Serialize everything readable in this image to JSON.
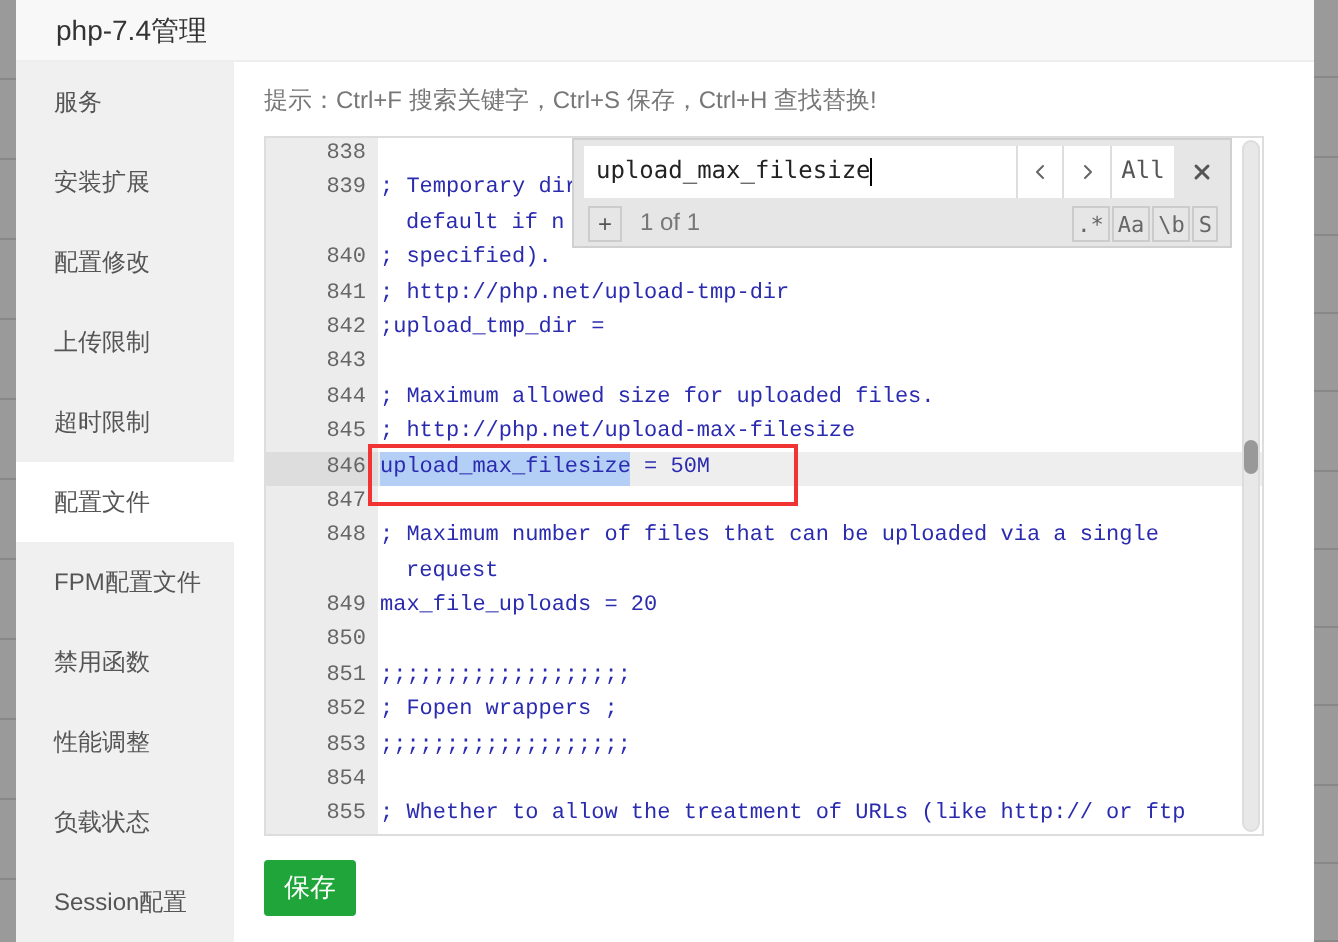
{
  "window": {
    "title": "php-7.4管理"
  },
  "sidebar": {
    "items": [
      {
        "label": "服务",
        "selected": false
      },
      {
        "label": "安装扩展",
        "selected": false
      },
      {
        "label": "配置修改",
        "selected": false
      },
      {
        "label": "上传限制",
        "selected": false
      },
      {
        "label": "超时限制",
        "selected": false
      },
      {
        "label": "配置文件",
        "selected": true
      },
      {
        "label": "FPM配置文件",
        "selected": false
      },
      {
        "label": "禁用函数",
        "selected": false
      },
      {
        "label": "性能调整",
        "selected": false
      },
      {
        "label": "负载状态",
        "selected": false
      },
      {
        "label": "Session配置",
        "selected": false
      }
    ]
  },
  "hint": "提示：Ctrl+F 搜索关键字，Ctrl+S 保存，Ctrl+H 查找替换!",
  "editor": {
    "lines": [
      {
        "number": "838",
        "current": false
      },
      {
        "number": "839",
        "text": "; Temporary dir",
        "continuation": "default if n",
        "current": false
      },
      {
        "number": "840",
        "text": "; specified).",
        "current": false
      },
      {
        "number": "841",
        "text": "; http://php.net/upload-tmp-dir",
        "current": false
      },
      {
        "number": "842",
        "text": ";upload_tmp_dir =",
        "current": false
      },
      {
        "number": "843",
        "current": false
      },
      {
        "number": "844",
        "text": "; Maximum allowed size for uploaded files.",
        "current": false
      },
      {
        "number": "845",
        "text": "; http://php.net/upload-max-filesize",
        "current": false
      },
      {
        "number": "846",
        "match": "upload_max_filesize",
        "text": " = 50M",
        "current": true,
        "highlighted": true
      },
      {
        "number": "847",
        "current": false
      },
      {
        "number": "848",
        "text": "; Maximum number of files that can be uploaded via a single",
        "continuation": "request",
        "current": false
      },
      {
        "number": "849",
        "text": "max_file_uploads = 20",
        "current": false
      },
      {
        "number": "850",
        "current": false
      },
      {
        "number": "851",
        "text": ";;;;;;;;;;;;;;;;;;;",
        "current": false
      },
      {
        "number": "852",
        "text": "; Fopen wrappers ;",
        "current": false
      },
      {
        "number": "853",
        "text": ";;;;;;;;;;;;;;;;;;;",
        "current": false
      },
      {
        "number": "854",
        "current": false
      },
      {
        "number": "855",
        "text": "; Whether to allow the treatment of URLs (like http:// or ftp",
        "current": false
      }
    ]
  },
  "search": {
    "query": "upload_max_filesize",
    "all": "All",
    "plus": "+",
    "count": "1 of 1",
    "options": [
      ".*",
      "Aa",
      "\\b",
      "S"
    ]
  },
  "save_button": "保存"
}
